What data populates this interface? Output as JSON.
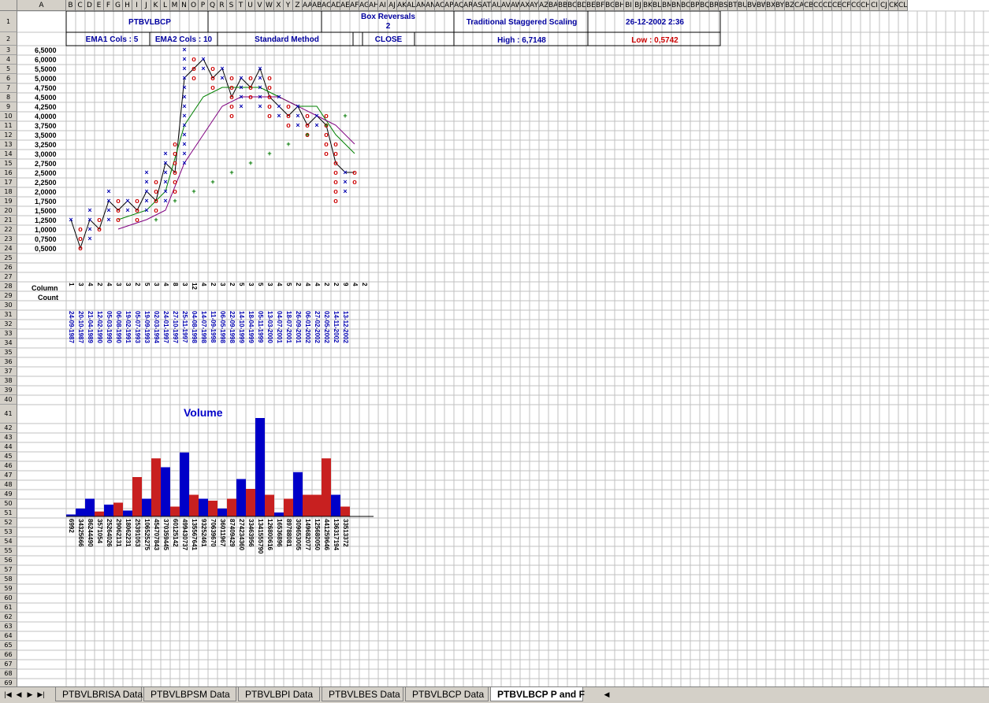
{
  "header": {
    "ticker": "PTBVLBCP",
    "box_reversals_label": "Box Reversals",
    "box_reversals_value": "2",
    "scaling": "Traditional Staggered Scaling",
    "timestamp": "26-12-2002 2:36",
    "ema1": "EMA1 Cols : 5",
    "ema2": "EMA2 Cols : 10",
    "method": "Standard Method",
    "close": "CLOSE",
    "high": "High : 6,7148",
    "low": "Low : 0,5742"
  },
  "column_letters": [
    "A",
    "B",
    "C",
    "D",
    "E",
    "F",
    "G",
    "H",
    "I",
    "J",
    "K",
    "L",
    "M",
    "N",
    "O",
    "P",
    "Q",
    "R",
    "S",
    "T",
    "U",
    "V",
    "W",
    "X",
    "Y",
    "Z",
    "AA",
    "AB",
    "AC",
    "AD",
    "AE",
    "AF",
    "AG",
    "AH",
    "AI",
    "AJ",
    "AK",
    "AL",
    "AM",
    "AN",
    "AO",
    "AP",
    "AQ",
    "AR",
    "AS",
    "AT",
    "AU",
    "AV",
    "AW",
    "AX",
    "AY",
    "AZ",
    "BA",
    "BB",
    "BC",
    "BD",
    "BE",
    "BF",
    "BG",
    "BH",
    "BI",
    "BJ",
    "BK",
    "BL",
    "BM",
    "BN",
    "BO",
    "BP",
    "BQ",
    "BR",
    "BS",
    "BT",
    "BU",
    "BV",
    "BW",
    "BX",
    "BY",
    "BZ",
    "CA",
    "CB",
    "CC",
    "CD",
    "CE",
    "CF",
    "CG",
    "CH",
    "CI",
    "CJ",
    "CK",
    "CL"
  ],
  "price_levels": [
    "6,5000",
    "6,0000",
    "5,5000",
    "5,0000",
    "4,7500",
    "4,5000",
    "4,2500",
    "4,0000",
    "3,7500",
    "3,5000",
    "3,2500",
    "3,0000",
    "2,7500",
    "2,5000",
    "2,2500",
    "2,0000",
    "1,7500",
    "1,5000",
    "1,2500",
    "1,0000",
    "0,7500",
    "0,5000"
  ],
  "labels": {
    "column": "Column",
    "count": "Count",
    "volume": "Volume"
  },
  "column_counts": [
    "1",
    "3",
    "4",
    "2",
    "4",
    "3",
    "3",
    "2",
    "5",
    "3",
    "4",
    "8",
    "3",
    "12",
    "4",
    "2",
    "3",
    "2",
    "5",
    "3",
    "5",
    "3",
    "4",
    "5",
    "2",
    "4",
    "4",
    "2",
    "2",
    "9",
    "4",
    "2"
  ],
  "dates": [
    "24-09-1987",
    "20-10-1987",
    "21-04-1989",
    "12-02-1990",
    "05-03-1990",
    "06-08-1990",
    "19-02-1991",
    "05-07-1993",
    "19-09-1993",
    "02-03-1994",
    "24-01-1997",
    "27-10-1997",
    "25-11-1997",
    "04-08-1998",
    "14-07-1998",
    "11-09-1998",
    "06-05-1998",
    "22-09-1998",
    "14-10-1999",
    "18-04-1999",
    "05-11-1999",
    "13-03-2000",
    "04-07-2001",
    "18-07-2001",
    "26-09-2001",
    "06-01-2002",
    "27-02-2002",
    "02-05-2002",
    "14-11-2002",
    "13-12-2002"
  ],
  "volumes": [
    "6992",
    "34325666",
    "86244490",
    "3571054",
    "25264026",
    "29062131",
    "18062231",
    "25391053",
    "106525275",
    "454707843",
    "370359445",
    "60125142",
    "499430737",
    "135567641",
    "93252461",
    "70639670",
    "36011967",
    "87409429",
    "274234360",
    "33463956",
    "1341555790",
    "126800616",
    "16536896",
    "89788081",
    "309653005",
    "149682077",
    "125680050",
    "441259646",
    "136317194",
    "33513372"
  ],
  "volume_colors": [
    "blue",
    "blue",
    "blue",
    "red",
    "blue",
    "red",
    "blue",
    "red",
    "blue",
    "red",
    "blue",
    "red",
    "blue",
    "red",
    "blue",
    "red",
    "blue",
    "red",
    "blue",
    "red",
    "blue",
    "red",
    "blue",
    "red",
    "blue",
    "red",
    "red",
    "red",
    "blue",
    "red"
  ],
  "volume_heights": [
    0.02,
    0.08,
    0.18,
    0.05,
    0.12,
    0.14,
    0.06,
    0.4,
    0.18,
    0.59,
    0.5,
    0.1,
    0.65,
    0.22,
    0.18,
    0.16,
    0.08,
    0.18,
    0.38,
    0.28,
    1.0,
    0.22,
    0.04,
    0.18,
    0.45,
    0.22,
    0.22,
    0.59,
    0.22,
    0.1
  ],
  "tabs": [
    "PTBVLBRISA Data",
    "PTBVLBPSM Data",
    "PTBVLBPI Data",
    "PTBVLBES Data",
    "PTBVLBCP Data",
    "PTBVLBCP P and F"
  ],
  "active_tab": 5,
  "colors": {
    "x": "#0000b0",
    "o": "#cc0000",
    "plus": "#007700",
    "volume_blue": "#0000c8",
    "volume_red": "#c82020"
  }
}
